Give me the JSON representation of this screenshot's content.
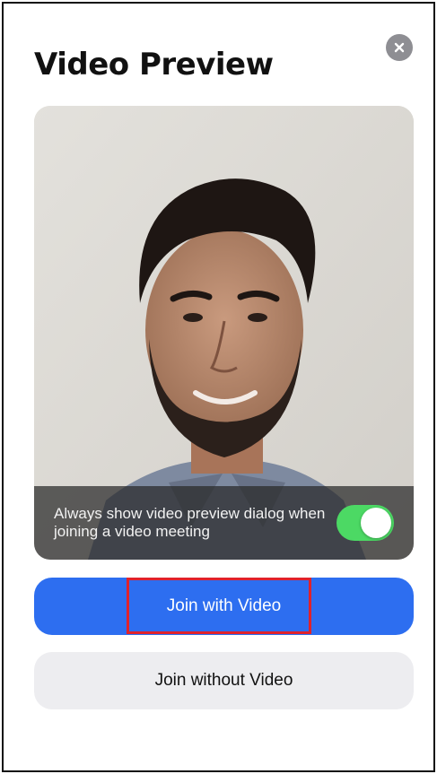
{
  "dialog": {
    "title": "Video Preview",
    "close_icon": "close-icon"
  },
  "preview": {
    "overlay_text": "Always show video preview dialog when joining a video meeting",
    "toggle_on": true,
    "toggle_color": "#4cd964"
  },
  "buttons": {
    "join_with_video": "Join with Video",
    "join_without_video": "Join without Video"
  },
  "colors": {
    "primary": "#2d6ef0",
    "secondary_button": "#ededf0",
    "highlight": "#e0222b"
  }
}
